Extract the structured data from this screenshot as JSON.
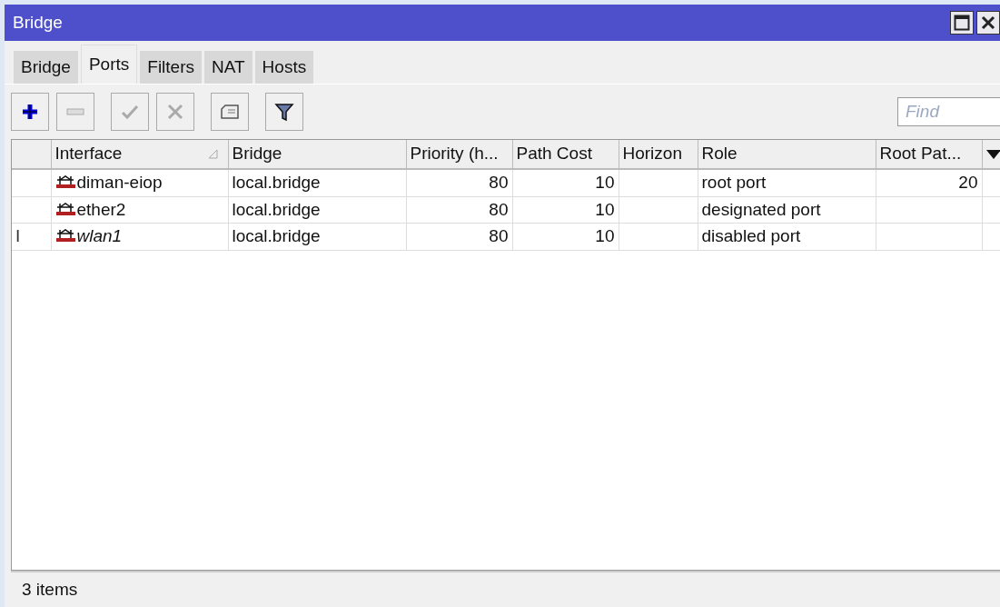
{
  "window": {
    "title": "Bridge"
  },
  "tabs": [
    {
      "label": "Bridge",
      "selected": false
    },
    {
      "label": "Ports",
      "selected": true
    },
    {
      "label": "Filters",
      "selected": false
    },
    {
      "label": "NAT",
      "selected": false
    },
    {
      "label": "Hosts",
      "selected": false
    }
  ],
  "toolbar": [
    {
      "kind": "add",
      "disabled": false
    },
    {
      "kind": "remove",
      "disabled": true
    },
    {
      "kind": "enable",
      "disabled": true
    },
    {
      "kind": "disable",
      "disabled": true
    },
    {
      "kind": "comment",
      "disabled": false
    },
    {
      "kind": "filter",
      "disabled": false
    }
  ],
  "search": {
    "placeholder": "Find"
  },
  "table": {
    "columns": [
      {
        "label": "Interface",
        "sorted": true
      },
      {
        "label": "Bridge",
        "sorted": false
      },
      {
        "label": "Priority (h...",
        "sorted": false
      },
      {
        "label": "Path Cost",
        "sorted": false
      },
      {
        "label": "Horizon",
        "sorted": false
      },
      {
        "label": "Role",
        "sorted": false
      },
      {
        "label": "Root Pat...",
        "sorted": false
      }
    ],
    "rows": [
      {
        "inactive": false,
        "cells": [
          "diman-eiop",
          "local.bridge",
          "80",
          "10",
          "",
          "root port",
          "20"
        ]
      },
      {
        "inactive": false,
        "cells": [
          "ether2",
          "local.bridge",
          "80",
          "10",
          "",
          "designated port",
          ""
        ]
      },
      {
        "inactive": true,
        "flag": "I",
        "cells": [
          "wlan1",
          "local.bridge",
          "80",
          "10",
          "",
          "disabled port",
          ""
        ]
      }
    ]
  },
  "status_bar": "3 items"
}
